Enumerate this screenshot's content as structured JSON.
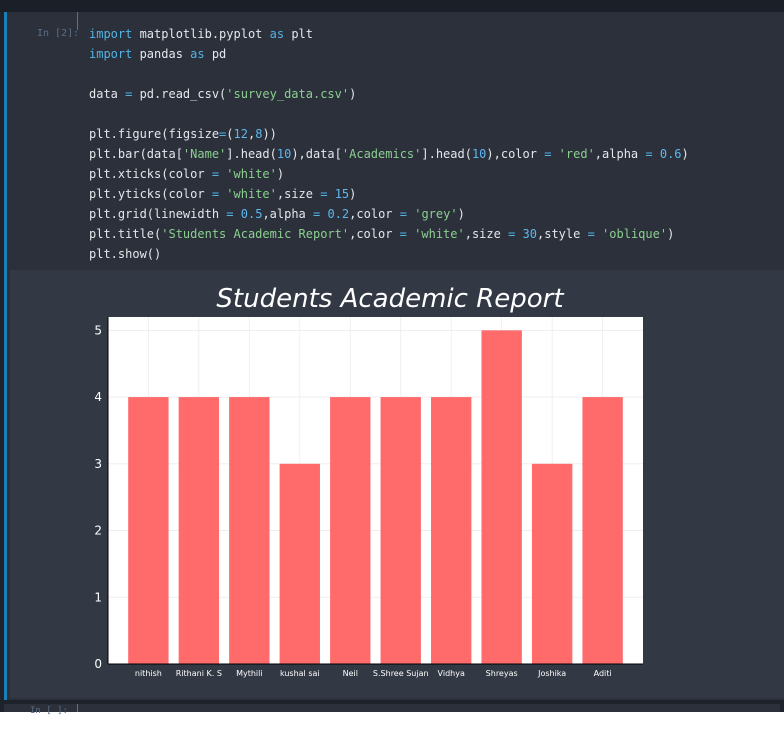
{
  "cell": {
    "prompt": "In [2]:",
    "code": [
      [
        {
          "t": "import",
          "c": "kw"
        },
        {
          "t": " matplotlib.pyplot "
        },
        {
          "t": "as",
          "c": "kw"
        },
        {
          "t": " plt"
        }
      ],
      [
        {
          "t": "import",
          "c": "kw"
        },
        {
          "t": " pandas "
        },
        {
          "t": "as",
          "c": "kw"
        },
        {
          "t": " pd"
        }
      ],
      [],
      [
        {
          "t": "data "
        },
        {
          "t": "=",
          "c": "op"
        },
        {
          "t": " pd.read_csv("
        },
        {
          "t": "'survey_data.csv'",
          "c": "str"
        },
        {
          "t": ")"
        }
      ],
      [],
      [
        {
          "t": "plt.figure(figsize"
        },
        {
          "t": "=",
          "c": "op"
        },
        {
          "t": "("
        },
        {
          "t": "12",
          "c": "num"
        },
        {
          "t": ","
        },
        {
          "t": "8",
          "c": "num"
        },
        {
          "t": "))"
        }
      ],
      [
        {
          "t": "plt.bar(data["
        },
        {
          "t": "'Name'",
          "c": "str"
        },
        {
          "t": "].head("
        },
        {
          "t": "10",
          "c": "num"
        },
        {
          "t": "),data["
        },
        {
          "t": "'Academics'",
          "c": "str"
        },
        {
          "t": "].head("
        },
        {
          "t": "10",
          "c": "num"
        },
        {
          "t": "),color "
        },
        {
          "t": "=",
          "c": "op"
        },
        {
          "t": " "
        },
        {
          "t": "'red'",
          "c": "str"
        },
        {
          "t": ",alpha "
        },
        {
          "t": "=",
          "c": "op"
        },
        {
          "t": " "
        },
        {
          "t": "0.6",
          "c": "num"
        },
        {
          "t": ")"
        }
      ],
      [
        {
          "t": "plt.xticks(color "
        },
        {
          "t": "=",
          "c": "op"
        },
        {
          "t": " "
        },
        {
          "t": "'white'",
          "c": "str"
        },
        {
          "t": ")"
        }
      ],
      [
        {
          "t": "plt.yticks(color "
        },
        {
          "t": "=",
          "c": "op"
        },
        {
          "t": " "
        },
        {
          "t": "'white'",
          "c": "str"
        },
        {
          "t": ",size "
        },
        {
          "t": "=",
          "c": "op"
        },
        {
          "t": " "
        },
        {
          "t": "15",
          "c": "num"
        },
        {
          "t": ")"
        }
      ],
      [
        {
          "t": "plt.grid(linewidth "
        },
        {
          "t": "=",
          "c": "op"
        },
        {
          "t": " "
        },
        {
          "t": "0.5",
          "c": "num"
        },
        {
          "t": ",alpha "
        },
        {
          "t": "=",
          "c": "op"
        },
        {
          "t": " "
        },
        {
          "t": "0.2",
          "c": "num"
        },
        {
          "t": ",color "
        },
        {
          "t": "=",
          "c": "op"
        },
        {
          "t": " "
        },
        {
          "t": "'grey'",
          "c": "str"
        },
        {
          "t": ")"
        }
      ],
      [
        {
          "t": "plt.title("
        },
        {
          "t": "'Students Academic Report'",
          "c": "str"
        },
        {
          "t": ",color "
        },
        {
          "t": "=",
          "c": "op"
        },
        {
          "t": " "
        },
        {
          "t": "'white'",
          "c": "str"
        },
        {
          "t": ",size "
        },
        {
          "t": "=",
          "c": "op"
        },
        {
          "t": " "
        },
        {
          "t": "30",
          "c": "num"
        },
        {
          "t": ",style "
        },
        {
          "t": "=",
          "c": "op"
        },
        {
          "t": " "
        },
        {
          "t": "'oblique'",
          "c": "str"
        },
        {
          "t": ")"
        }
      ],
      [
        {
          "t": "plt.show()"
        }
      ]
    ]
  },
  "next_cell": {
    "prompt": "In [ ]:"
  },
  "colors": {
    "bar": "#ff6b6b",
    "cell_border": "#1a7fb6",
    "keyword": "#52b3e6",
    "string": "#8bcf8f"
  },
  "chart_data": {
    "type": "bar",
    "title": "Students Academic Report",
    "categories": [
      "nithish",
      "Rithani K. S",
      "Mythili",
      "kushal sai",
      "Neil",
      "S.Shree Sujan",
      "Vidhya",
      "Shreyas",
      "Joshika",
      "Aditi"
    ],
    "values": [
      4,
      4,
      4,
      3,
      4,
      4,
      4,
      5,
      3,
      4
    ],
    "yticks": [
      "0",
      "1",
      "2",
      "3",
      "4",
      "5"
    ],
    "ylim": [
      0,
      5.2
    ],
    "grid": true,
    "xlabel": "",
    "ylabel": ""
  }
}
